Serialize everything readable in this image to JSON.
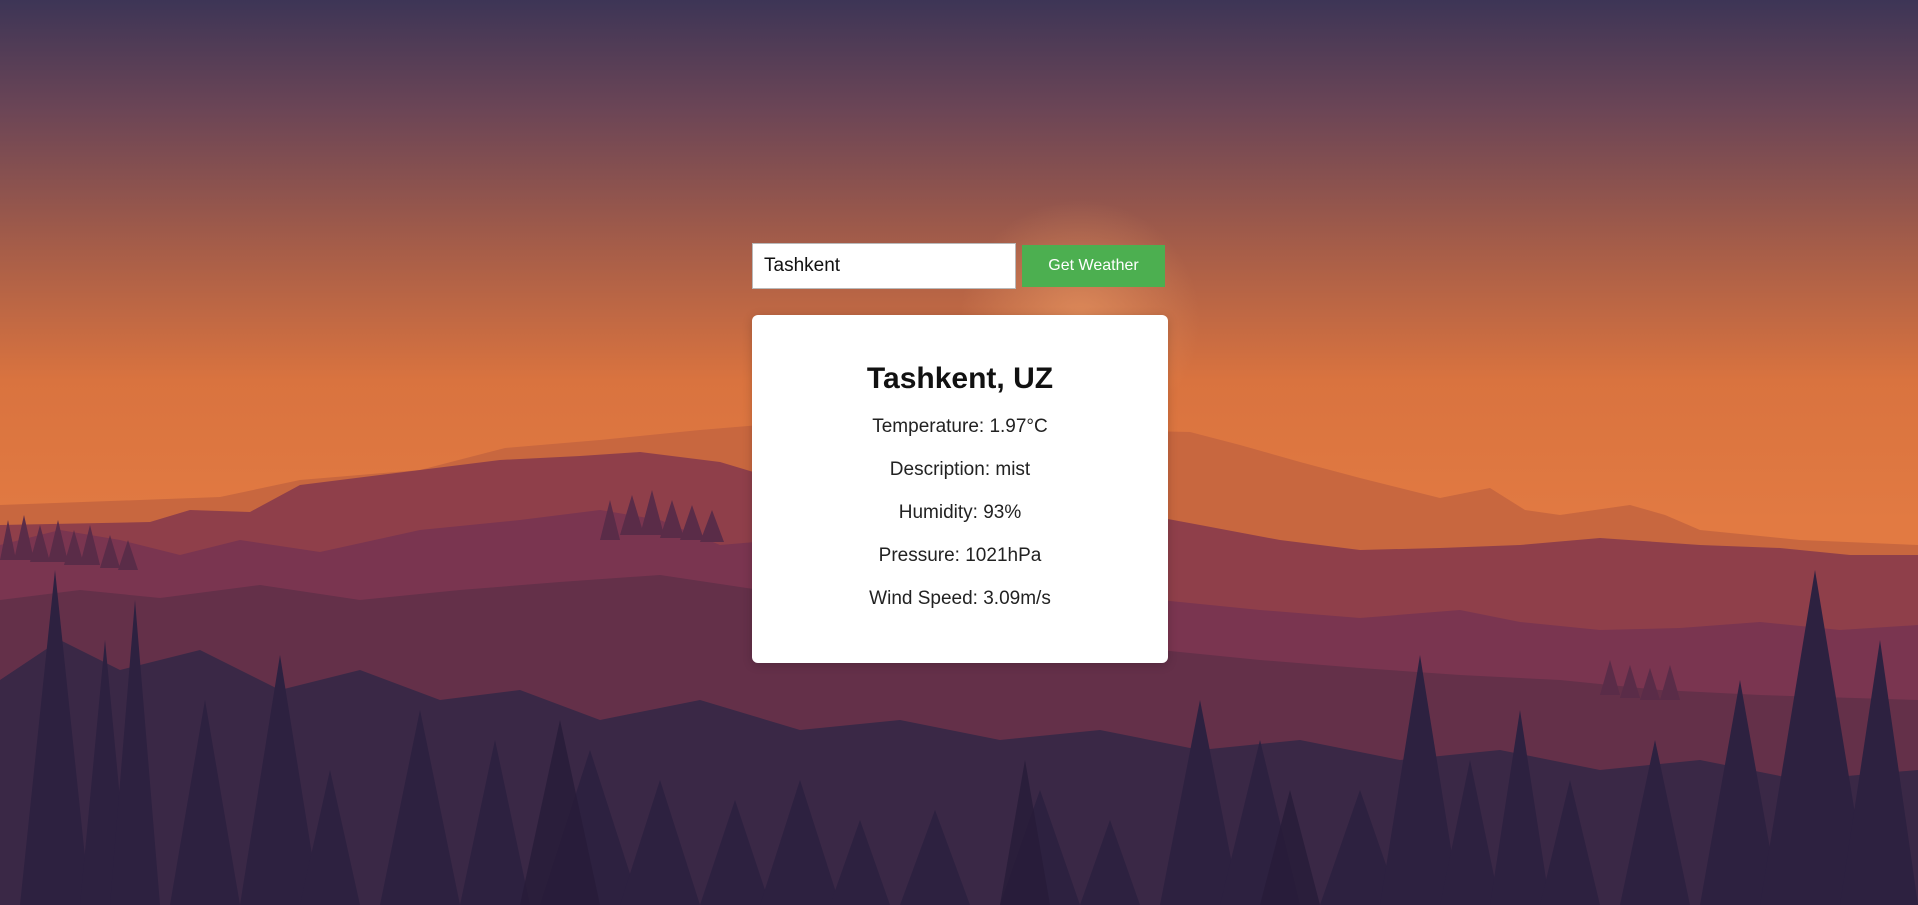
{
  "search": {
    "value": "Tashkent",
    "button_label": "Get Weather"
  },
  "weather": {
    "location": "Tashkent, UZ",
    "temperature": "Temperature: 1.97°C",
    "description": "Description: mist",
    "humidity": "Humidity: 93%",
    "pressure": "Pressure: 1021hPa",
    "wind_speed": "Wind Speed: 3.09m/s"
  },
  "colors": {
    "button": "#4caf50",
    "sky_top": "#3d3556",
    "sky_mid": "#e07a42",
    "forest": "#2d2140"
  }
}
